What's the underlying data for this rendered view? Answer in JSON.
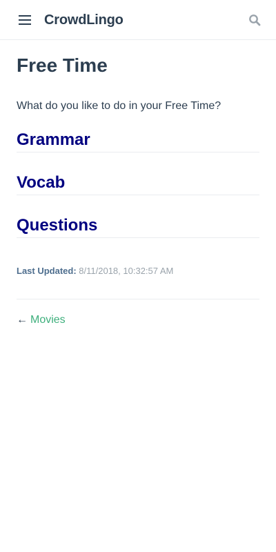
{
  "navbar": {
    "site_name": "CrowdLingo",
    "icons": {
      "menu": "hamburger-menu-icon",
      "search": "search-icon"
    }
  },
  "page": {
    "title": "Free Time",
    "intro": "What do you like to do in your Free Time?",
    "sections": [
      {
        "label": "Grammar"
      },
      {
        "label": "Vocab"
      },
      {
        "label": "Questions"
      }
    ],
    "last_updated": {
      "prefix": "Last Updated:",
      "time": "8/11/2018, 10:32:57 AM"
    },
    "prev_link": {
      "arrow": "←",
      "label": "Movies"
    }
  },
  "colors": {
    "text": "#2c3e50",
    "section_link": "#000080",
    "accent": "#3eaf7c",
    "muted": "#9aa3ab",
    "border": "#eaecef"
  }
}
